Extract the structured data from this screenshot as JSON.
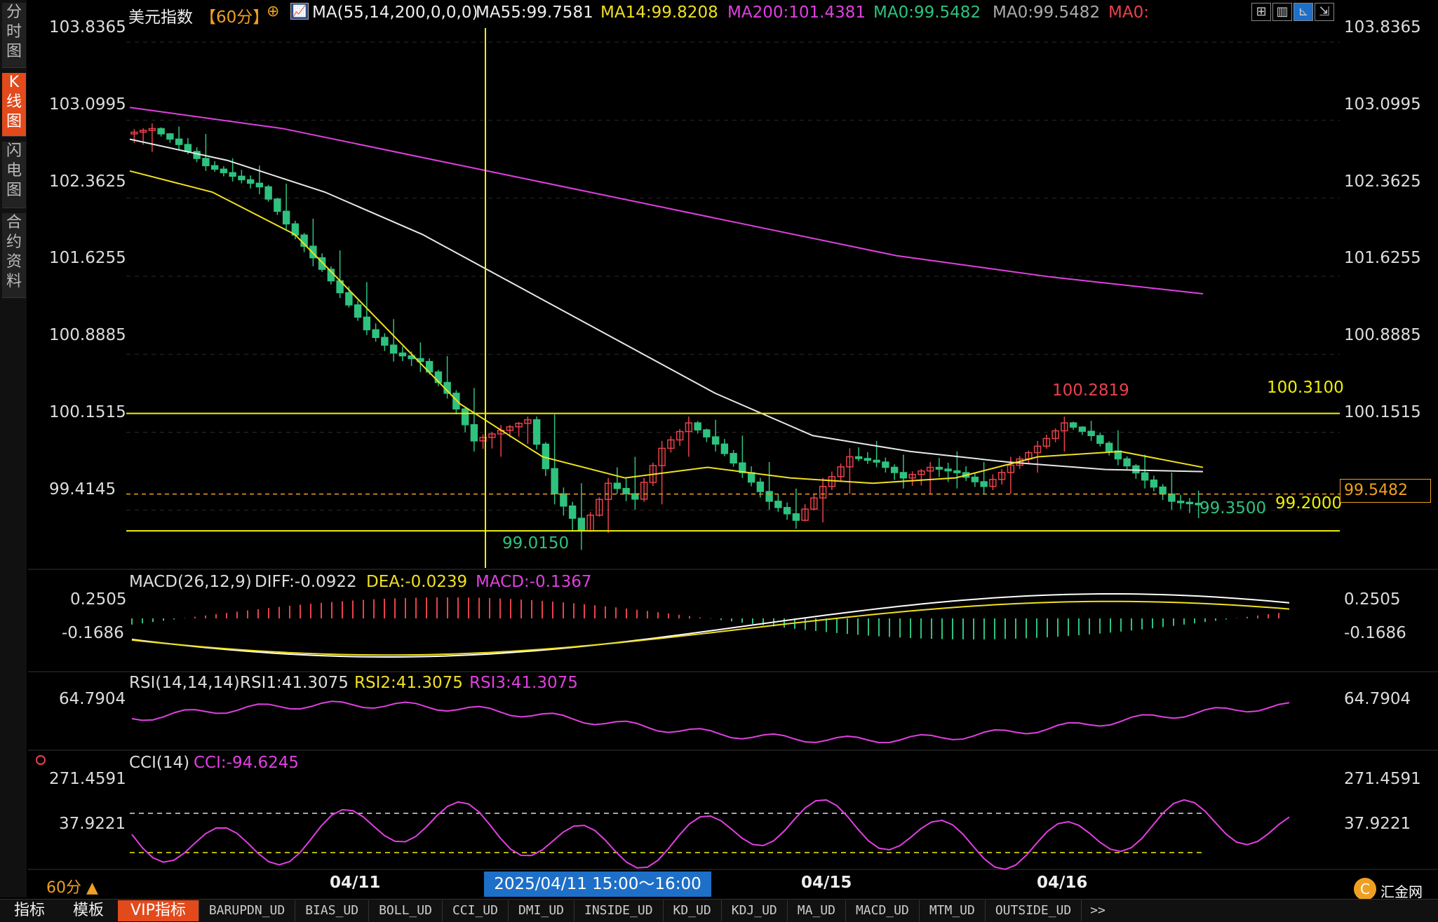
{
  "header": {
    "symbol": "美元指数",
    "period": "【60分】",
    "ma_spec": "MA(55,14,200,0,0,0)",
    "ma55": "MA55:99.7581",
    "ma14": "MA14:99.8208",
    "ma200": "MA200:101.4381",
    "ma0_a": "MA0:99.5482",
    "ma0_b": "MA0:99.5482",
    "ma0_c": "MA0:"
  },
  "sidebar": {
    "tabs": [
      {
        "label": "分时图"
      },
      {
        "label": "K线图"
      },
      {
        "label": "闪电图"
      },
      {
        "label": "合约资料"
      }
    ]
  },
  "price_axis": {
    "ticks": [
      "103.8365",
      "103.0995",
      "102.3625",
      "101.6255",
      "100.8885",
      "100.1515",
      "99.4145"
    ],
    "values": [
      103.8365,
      103.0995,
      102.3625,
      101.6255,
      100.8885,
      100.1515,
      99.4145
    ]
  },
  "annotations": {
    "low": "99.0150",
    "high": "100.2819",
    "last_low": "99.3500",
    "resistance": "100.3100",
    "support": "99.2000",
    "current_price": "99.5482"
  },
  "macd": {
    "title": "MACD(26,12,9)",
    "diff": "DIFF:-0.0922",
    "dea": "DEA:-0.0239",
    "macd": "MACD:-0.1367",
    "ticks": [
      "0.2505",
      "-0.1686"
    ]
  },
  "rsi": {
    "title": "RSI(14,14,14)",
    "rsi1": "RSI1:41.3075",
    "rsi2": "RSI2:41.3075",
    "rsi3": "RSI3:41.3075",
    "ticks": [
      "64.7904"
    ]
  },
  "cci": {
    "title": "CCI(14)",
    "cci": "CCI:-94.6245",
    "ticks": [
      "271.4591",
      "37.9221"
    ]
  },
  "time_axis": {
    "labels": [
      "04/11",
      "04/15",
      "04/16"
    ],
    "crosshair": "2025/04/11 15:00～16:00 五",
    "period_label": "60分 ▲"
  },
  "bottom_tabs": {
    "main": [
      "指标",
      "模板"
    ],
    "vip": "VIP指标",
    "indicators": [
      "BARUPDN_UD",
      "BIAS_UD",
      "BOLL_UD",
      "CCI_UD",
      "DMI_UD",
      "INSIDE_UD",
      "KD_UD",
      "KDJ_UD",
      "MA_UD",
      "MACD_UD",
      "MTM_UD",
      "OUTSIDE_UD"
    ],
    "more": ">>"
  },
  "brand": "汇金网",
  "colors": {
    "up": "#e8424b",
    "down": "#2ec27e",
    "ma14": "#f0e020",
    "ma55": "#e8e8e8",
    "ma200": "#e040e0",
    "level": "#f0f000",
    "accent": "#e24a1c"
  },
  "chart_data": {
    "type": "candlestick",
    "ylim": [
      98.85,
      103.95
    ],
    "candles_ohlc_hourly_sample": [
      [
        102.95,
        103.05,
        102.78,
        103.0
      ],
      [
        103.0,
        103.02,
        102.8,
        102.85
      ],
      [
        102.85,
        102.95,
        102.6,
        102.65
      ],
      [
        102.65,
        102.72,
        102.5,
        102.55
      ],
      [
        102.55,
        102.65,
        102.38,
        102.45
      ],
      [
        102.45,
        102.48,
        102.05,
        102.1
      ],
      [
        102.1,
        102.15,
        101.7,
        101.78
      ],
      [
        101.78,
        101.85,
        101.4,
        101.45
      ],
      [
        101.45,
        101.55,
        101.05,
        101.1
      ],
      [
        101.1,
        101.2,
        100.8,
        100.88
      ],
      [
        100.88,
        100.98,
        100.7,
        100.8
      ],
      [
        100.8,
        100.85,
        100.45,
        100.5
      ],
      [
        100.5,
        100.55,
        99.95,
        100.05
      ],
      [
        100.05,
        100.2,
        99.9,
        100.15
      ],
      [
        100.15,
        100.28,
        100.02,
        100.25
      ],
      [
        100.25,
        100.3,
        99.45,
        99.55
      ],
      [
        99.55,
        99.65,
        99.02,
        99.2
      ],
      [
        99.2,
        99.7,
        99.18,
        99.65
      ],
      [
        99.65,
        99.9,
        99.4,
        99.5
      ],
      [
        99.5,
        100.05,
        99.45,
        99.98
      ],
      [
        99.98,
        100.28,
        99.9,
        100.22
      ],
      [
        100.22,
        100.25,
        99.95,
        100.02
      ],
      [
        100.02,
        100.1,
        99.7,
        99.75
      ],
      [
        99.75,
        99.85,
        99.4,
        99.48
      ],
      [
        99.48,
        99.6,
        99.22,
        99.3
      ],
      [
        99.3,
        99.7,
        99.28,
        99.62
      ],
      [
        99.62,
        99.98,
        99.55,
        99.9
      ],
      [
        99.9,
        100.05,
        99.8,
        99.85
      ],
      [
        99.85,
        99.92,
        99.6,
        99.7
      ],
      [
        99.7,
        99.85,
        99.55,
        99.8
      ],
      [
        99.8,
        99.95,
        99.6,
        99.75
      ],
      [
        99.75,
        99.85,
        99.55,
        99.62
      ],
      [
        99.62,
        99.9,
        99.55,
        99.82
      ],
      [
        99.82,
        100.05,
        99.75,
        100.0
      ],
      [
        100.0,
        100.28,
        99.95,
        100.22
      ],
      [
        100.22,
        100.24,
        100.05,
        100.1
      ],
      [
        100.1,
        100.15,
        99.82,
        99.88
      ],
      [
        99.88,
        99.92,
        99.6,
        99.68
      ],
      [
        99.68,
        99.75,
        99.4,
        99.48
      ],
      [
        99.48,
        99.58,
        99.32,
        99.45
      ]
    ],
    "ma14": [
      102.6,
      102.4,
      102.0,
      101.2,
      100.4,
      99.9,
      99.7,
      99.8,
      99.7,
      99.65,
      99.7,
      99.9,
      99.95,
      99.8
    ],
    "ma55": [
      102.9,
      102.7,
      102.4,
      102.0,
      101.5,
      101.0,
      100.5,
      100.1,
      99.95,
      99.85,
      99.78,
      99.76
    ],
    "ma200": [
      103.2,
      103.0,
      102.7,
      102.4,
      102.1,
      101.8,
      101.6,
      101.44
    ]
  }
}
